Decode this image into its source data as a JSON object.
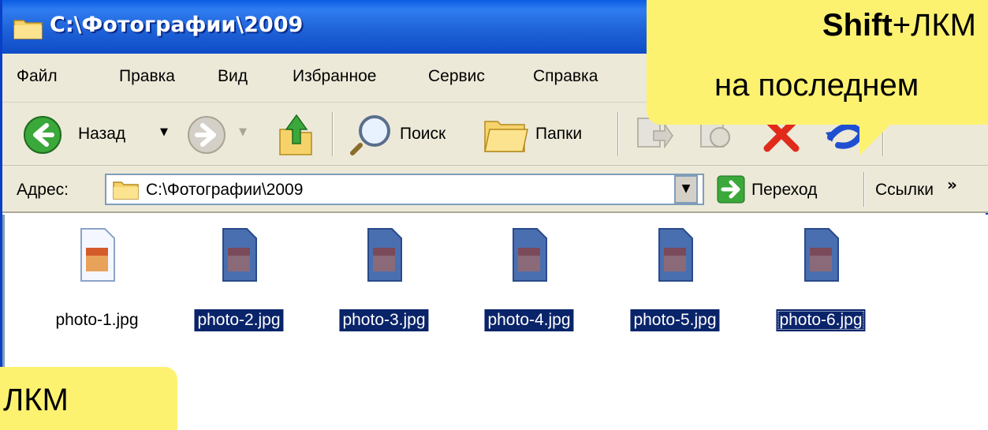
{
  "window": {
    "title": "C:\\Фотографии\\2009"
  },
  "menu": [
    "Файл",
    "Правка",
    "Вид",
    "Избранное",
    "Сервис",
    "Справка"
  ],
  "toolbar": {
    "back_label": "Назад",
    "search_label": "Поиск",
    "folders_label": "Папки"
  },
  "address": {
    "label": "Адрес:",
    "path": "C:\\Фотографии\\2009",
    "go_label": "Переход",
    "links_label": "Ссылки",
    "overflow": "»"
  },
  "files": [
    {
      "name": "photo-1.jpg",
      "selected": false
    },
    {
      "name": "photo-2.jpg",
      "selected": true
    },
    {
      "name": "photo-3.jpg",
      "selected": true
    },
    {
      "name": "photo-4.jpg",
      "selected": true
    },
    {
      "name": "photo-5.jpg",
      "selected": true
    },
    {
      "name": "photo-6.jpg",
      "selected": true,
      "focused": true
    }
  ],
  "callouts": {
    "top": {
      "key": "Shift",
      "action": "+ЛКМ",
      "line2": "на последнем"
    },
    "bottom": {
      "text": "ЛКМ"
    }
  },
  "colors": {
    "titlebar": "#0b5de2",
    "selection": "#0a246a",
    "callout": "#fdf270",
    "chrome": "#ece9d8"
  }
}
